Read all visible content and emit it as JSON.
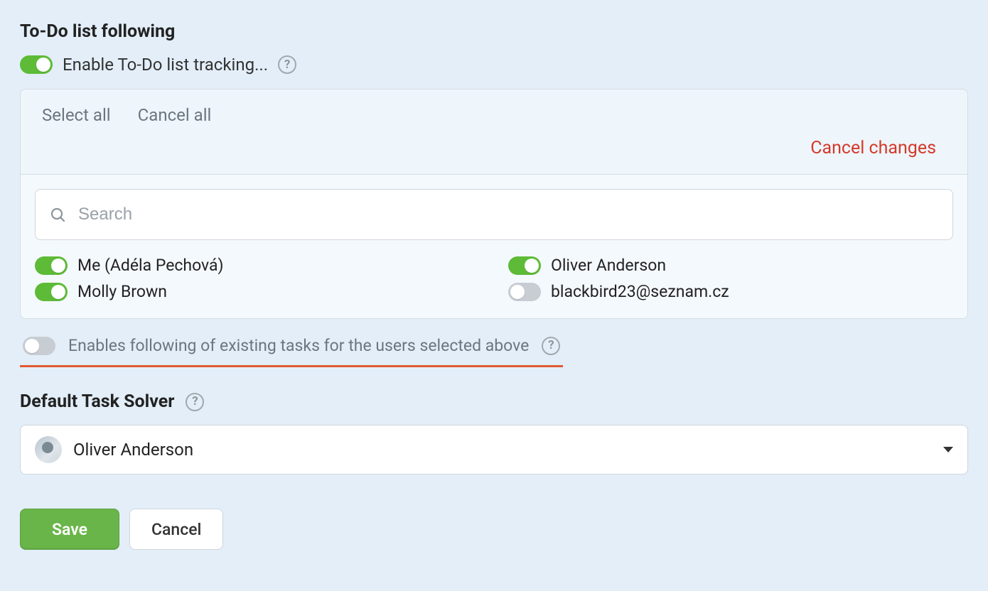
{
  "section1": {
    "title": "To-Do list following",
    "enable_label": "Enable To-Do list tracking...",
    "enable_on": true
  },
  "panel": {
    "select_all": "Select all",
    "cancel_all": "Cancel all",
    "cancel_changes": "Cancel changes",
    "search_placeholder": "Search",
    "users": [
      {
        "name": "Me (Adéla Pechová)",
        "on": true
      },
      {
        "name": "Oliver Anderson",
        "on": true
      },
      {
        "name": "Molly Brown",
        "on": true
      },
      {
        "name": "blackbird23@seznam.cz",
        "on": false
      }
    ]
  },
  "existing_tasks": {
    "label": "Enables following of existing tasks for the users selected above",
    "on": false
  },
  "solver": {
    "title": "Default Task Solver",
    "selected": "Oliver Anderson"
  },
  "buttons": {
    "save": "Save",
    "cancel": "Cancel"
  }
}
